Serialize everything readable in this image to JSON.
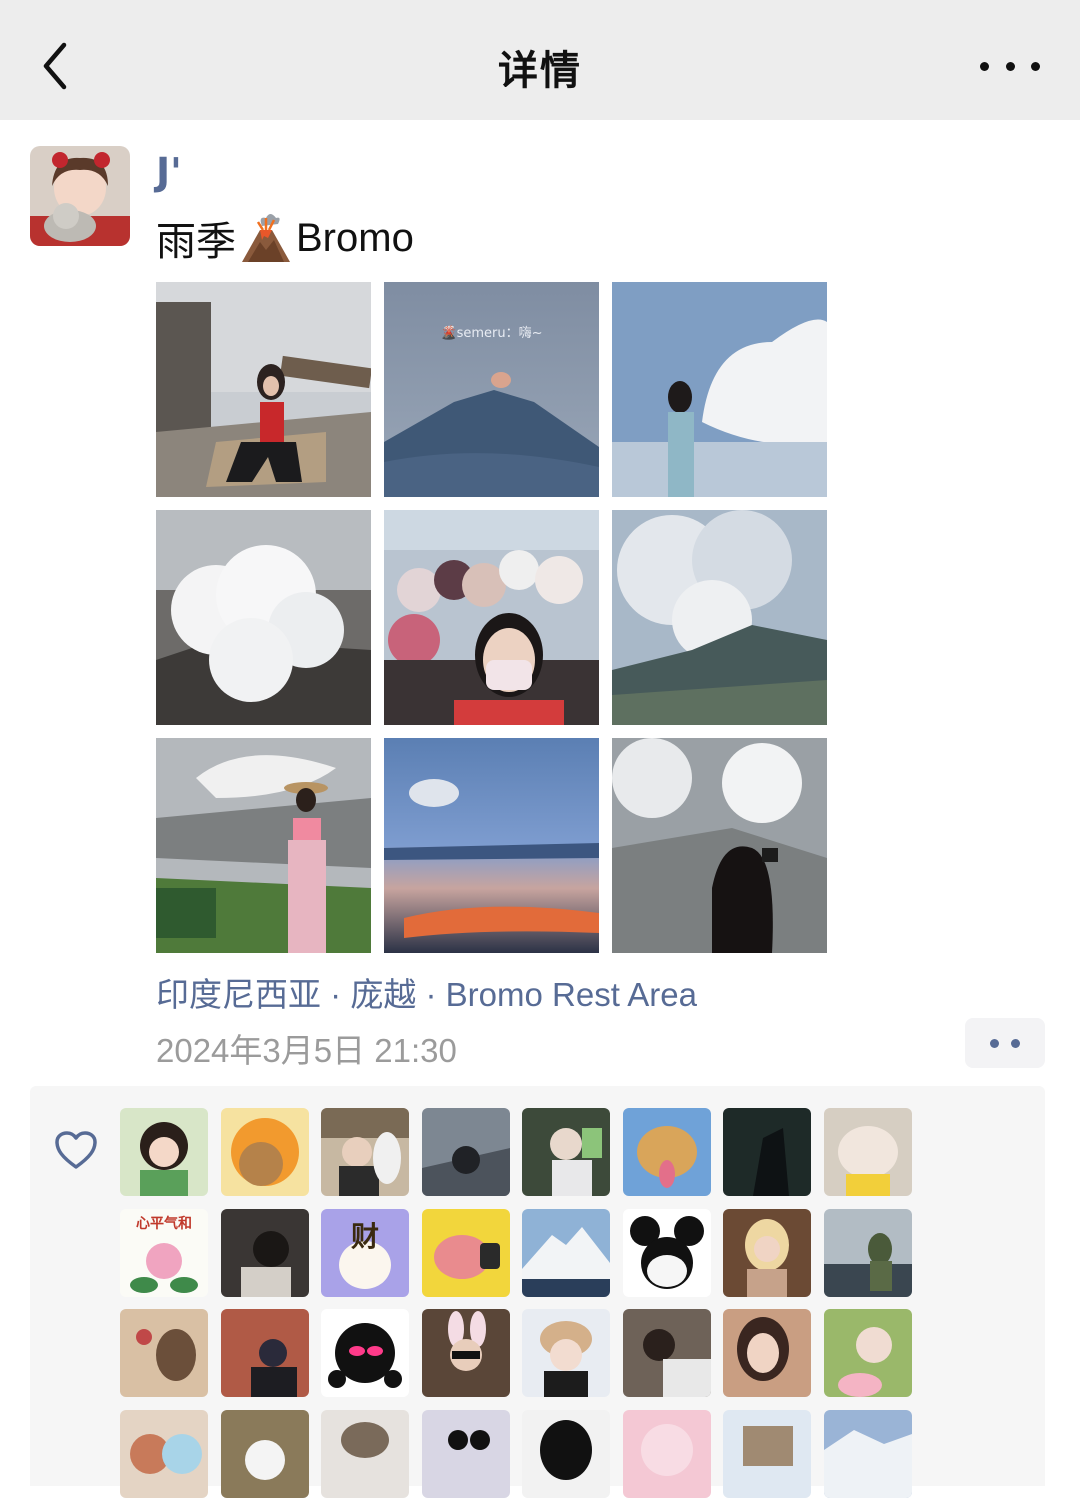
{
  "nav": {
    "title": "详情",
    "back_icon": "chevron-left-icon",
    "more_icon": "more-horizontal-icon"
  },
  "post": {
    "username": "J'",
    "text_before": "雨季",
    "text_emoji": "volcano-icon",
    "text_after": "Bromo",
    "photo_caption": "🌋semeru：嗨~",
    "location": "印度尼西亚 · 庞越 · Bromo Rest Area",
    "timestamp": "2024年3月5日 21:30"
  },
  "likes": {
    "icon": "heart-outline-icon",
    "avatar_text_0": "心平气和",
    "avatar_text_1": "财"
  },
  "colors": {
    "nav_bg": "#ededed",
    "link": "#576b95",
    "meta": "#9b9b9b",
    "likes_bg": "#f6f6f6"
  }
}
